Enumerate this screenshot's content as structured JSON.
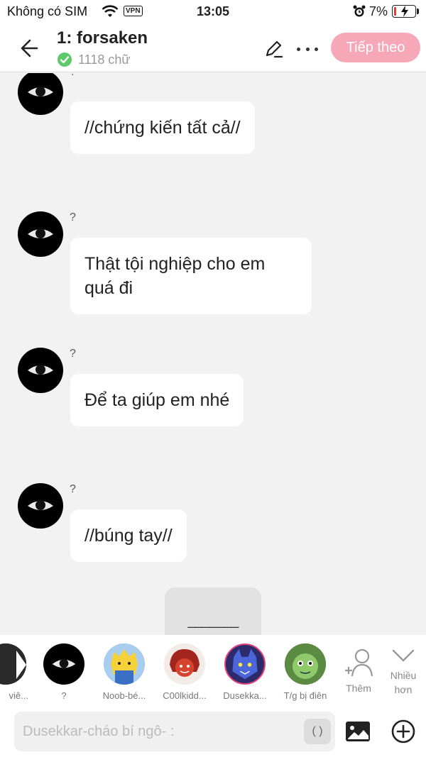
{
  "status_bar": {
    "carrier": "Không có SIM",
    "vpn": "VPN",
    "time": "13:05",
    "battery": "7%",
    "battery_level": 0.07
  },
  "header": {
    "back_icon": "arrow-left-icon",
    "title": "1: forsaken",
    "word_count": "1118 chữ",
    "edit_icon": "pencil-icon",
    "more_icon": "more-horizontal-icon",
    "next_label": "Tiếp theo",
    "accent": "#f7a8b8"
  },
  "messages": [
    {
      "sender": "?",
      "text": "//chứng kiến tất cả//"
    },
    {
      "sender": "?",
      "text": "Thật tội nghiệp cho em quá đi"
    },
    {
      "sender": "?",
      "text": "Để ta giúp em nhé"
    },
    {
      "sender": "?",
      "text": "//búng tay//"
    }
  ],
  "divider": {
    "text": "_______"
  },
  "characters": [
    {
      "label": "viê...",
      "icon": "partial-avatar"
    },
    {
      "label": "?",
      "icon": "eye-avatar"
    },
    {
      "label": "Noob-bé...",
      "icon": "yellow-character-avatar"
    },
    {
      "label": "C00lkidd...",
      "icon": "red-character-avatar"
    },
    {
      "label": "Dusekka...",
      "icon": "blue-character-avatar"
    },
    {
      "label": "T/g bị điên",
      "icon": "green-character-avatar"
    }
  ],
  "add_character": {
    "label": "Thêm",
    "icon": "add-person-icon"
  },
  "more_characters": {
    "label": "Nhiều hơn",
    "icon": "chevron-down-icon"
  },
  "input": {
    "placeholder": "Dusekkar-cháo bí ngô- :",
    "paren_label": "( )",
    "image_icon": "image-icon",
    "add_icon": "plus-circle-icon"
  }
}
